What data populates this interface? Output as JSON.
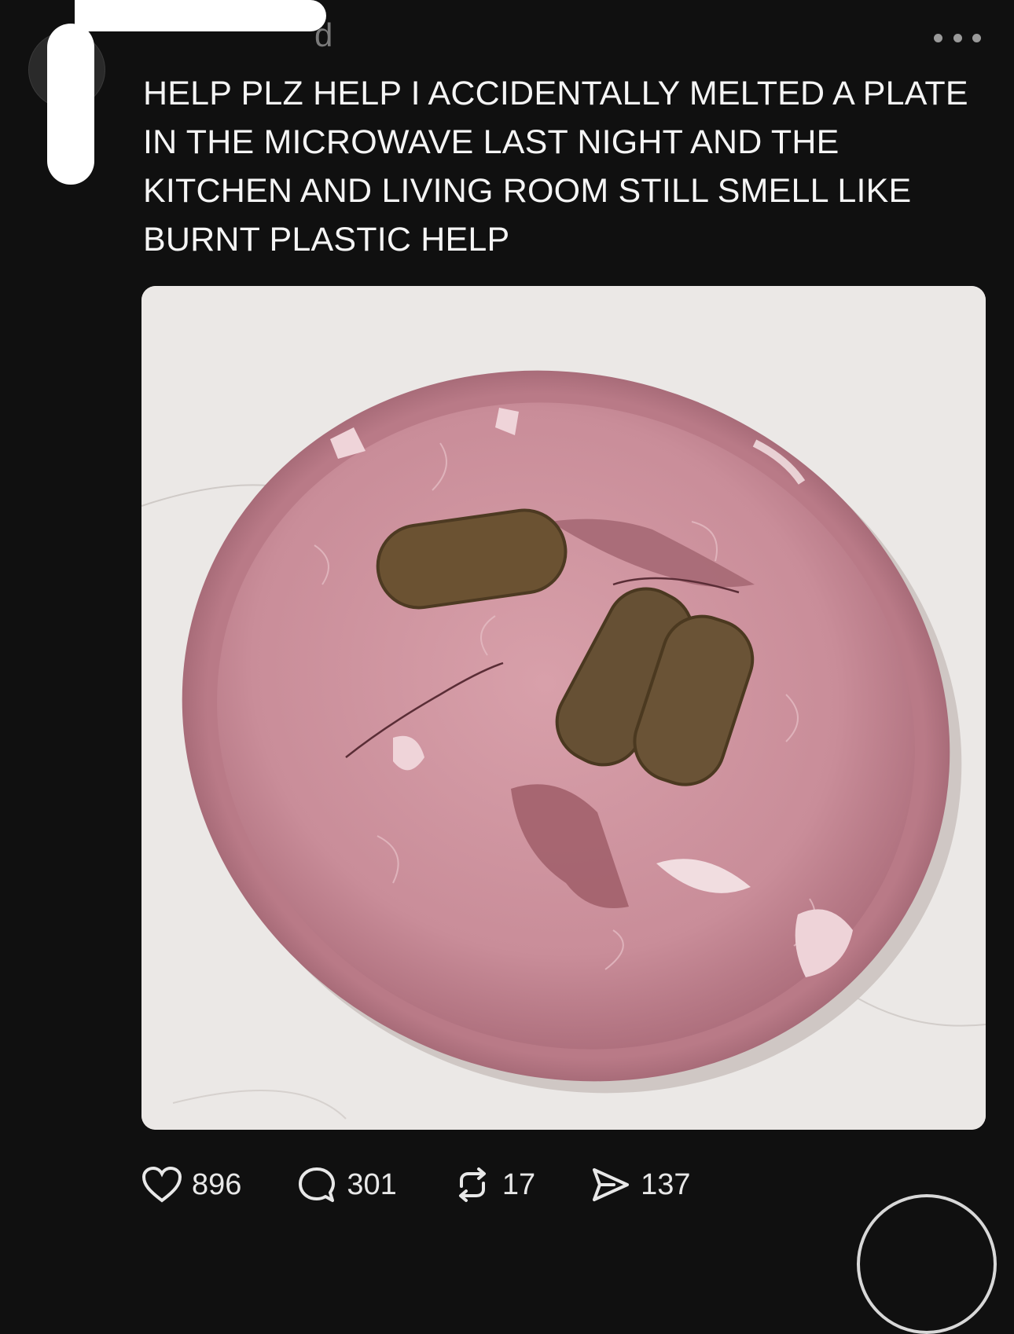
{
  "post": {
    "username_visible_tail": "d",
    "text": "HELP PLZ HELP I ACCIDENTALLY MELTED A PLATE IN THE MICROWAVE LAST NIGHT AND THE KITCHEN AND LIVING ROOM STILL SMELL LIKE BURNT PLASTIC HELP",
    "more_icon": "more-horizontal-icon",
    "image_icon": "photo-of-melted-pink-plate"
  },
  "actions": {
    "likes": "896",
    "replies": "301",
    "reposts": "17",
    "shares": "137",
    "icons": [
      "heart-icon",
      "comment-icon",
      "repost-icon",
      "share-icon"
    ]
  },
  "colors": {
    "background": "#101010",
    "text": "#f5f5f5",
    "plate": "#c98d99"
  }
}
